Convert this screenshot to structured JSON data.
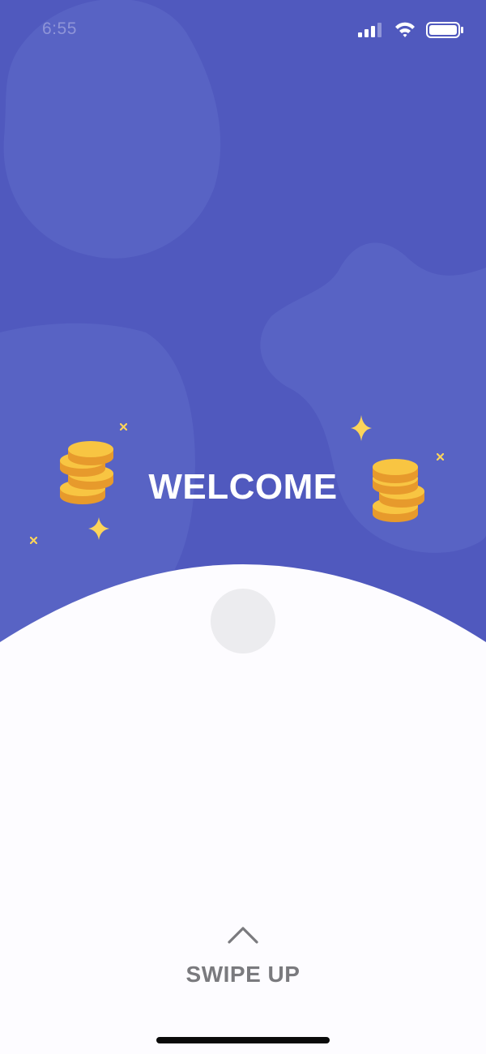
{
  "status_bar": {
    "time": "6:55",
    "icons": [
      "cellular-signal-icon",
      "wifi-icon",
      "battery-icon"
    ]
  },
  "hero": {
    "title": "WELCOME",
    "decorations": [
      "coin-stack-icon",
      "sparkle-icon"
    ]
  },
  "footer": {
    "chevron_icon": "chevron-up-icon",
    "swipe_label": "SWIPE UP"
  },
  "colors": {
    "hero_background": "#5059be",
    "blob": "#5a65c6",
    "sheet_background": "#fdfcff",
    "coin_gold": "#f8c542",
    "coin_shadow": "#e79a2c",
    "sparkle": "#fcd45a",
    "handle": "#ececef",
    "swipe_text": "#7a7a7e"
  }
}
